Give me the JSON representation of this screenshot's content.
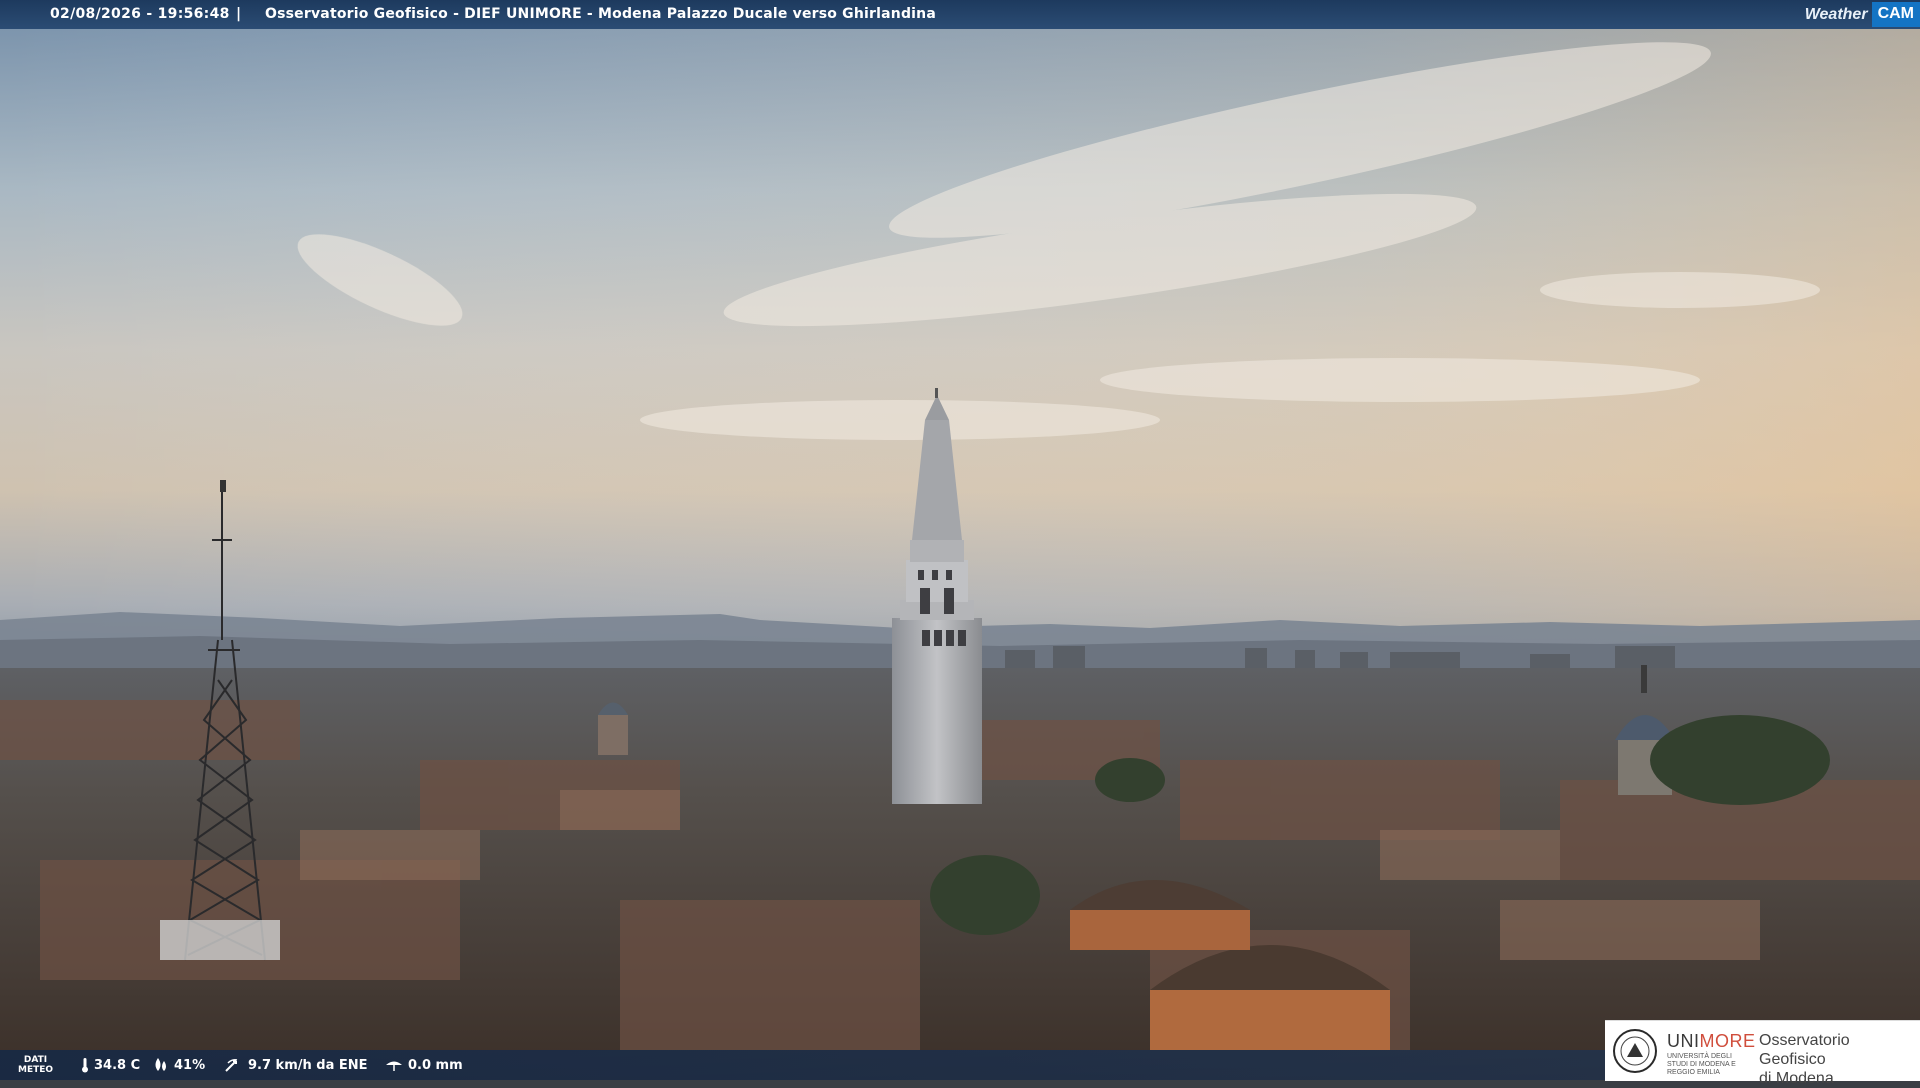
{
  "header": {
    "timestamp": "02/08/2026 - 19:56:48",
    "separator": "|",
    "camera_title": "Osservatorio Geofisico - DIEF UNIMORE - Modena Palazzo Ducale verso Ghirlandina",
    "brand_word": "Weather",
    "brand_cam": "CAM"
  },
  "weather": {
    "label_line1": "DATI",
    "label_line2": "METEO",
    "temperature": "34.8 C",
    "humidity": "41%",
    "wind": "9.7 km/h da ENE",
    "rain": "0.0 mm",
    "icons": [
      "thermometer-icon",
      "humidity-drop-icon",
      "wind-icon",
      "rain-gauge-icon"
    ]
  },
  "logo": {
    "uni_prefix": "UNI",
    "uni_suffix": "MORE",
    "uni_subtitle": "UNIVERSITÀ DEGLI STUDI DI MODENA E REGGIO EMILIA",
    "observatory_line1": "Osservatorio Geofisico",
    "observatory_line2": "di Modena"
  },
  "colors": {
    "header_bg": "#1d3a5e",
    "brand_blue": "#1474c4",
    "unimore_red": "#d04e3c"
  }
}
